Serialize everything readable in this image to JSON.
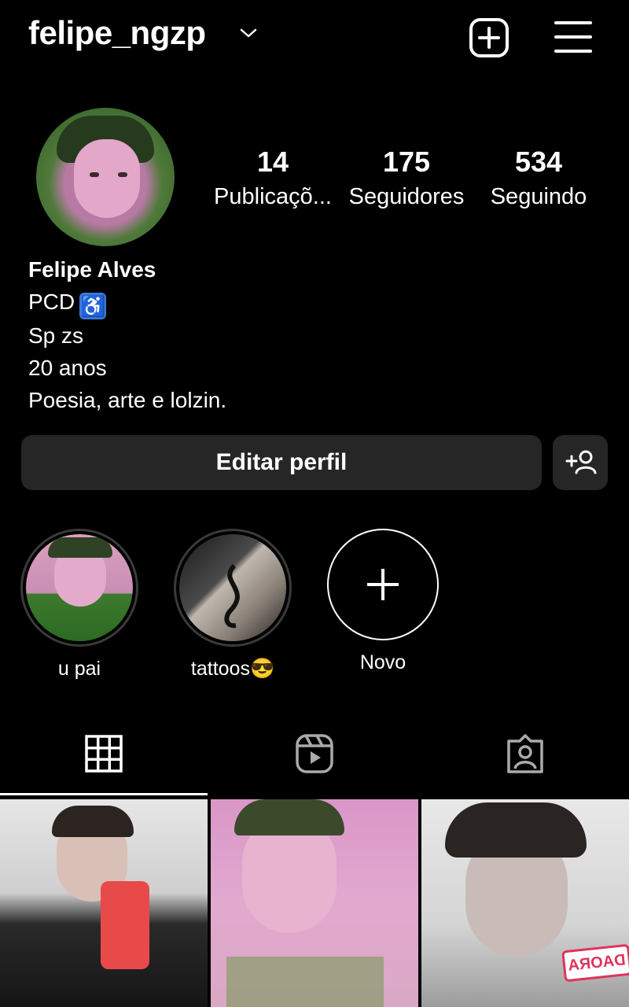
{
  "header": {
    "username": "felipe_ngzp",
    "chevron_icon": "chevron-down-icon",
    "new_post_icon": "plus-square-icon",
    "menu_icon": "hamburger-menu-icon"
  },
  "stats": [
    {
      "value": "14",
      "label": "Publicaçõ..."
    },
    {
      "value": "175",
      "label": "Seguidores"
    },
    {
      "value": "534",
      "label": "Seguindo"
    }
  ],
  "bio": {
    "name": "Felipe Alves",
    "line1": "PCD",
    "line1_emoji": "♿",
    "line2": "Sp zs",
    "line3": "20 anos",
    "line4": "Poesia, arte e lolzin."
  },
  "actions": {
    "edit_profile": "Editar perfil",
    "discover_icon": "add-person-icon"
  },
  "highlights": [
    {
      "label": "u pai"
    },
    {
      "label": "tattoos😎"
    },
    {
      "label": "Novo"
    }
  ],
  "tabs": [
    {
      "icon": "grid-icon",
      "active": true
    },
    {
      "icon": "reels-icon",
      "active": false
    },
    {
      "icon": "tagged-icon",
      "active": false
    }
  ],
  "posts": [
    {
      "overlay_text": ""
    },
    {
      "overlay_text": ""
    },
    {
      "overlay_text": "DAORA"
    }
  ],
  "colors": {
    "background": "#000000",
    "button_bg": "#262626",
    "text": "#ffffff"
  }
}
